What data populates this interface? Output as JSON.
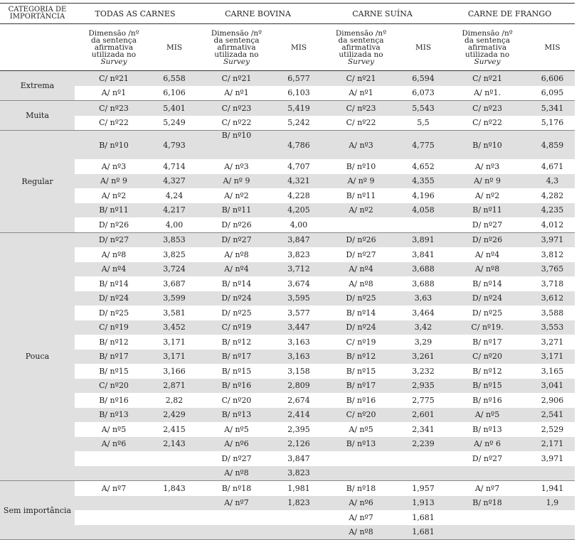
{
  "header": {
    "category": "CATEGORIA DE IMPORTÂNCIA",
    "groups": [
      "TODAS AS CARNES",
      "CARNE BOVINA",
      "CARNE SUÍNA",
      "CARNE DE FRANGO"
    ],
    "dim_lines": [
      "Dimensão /nº",
      "da sentença",
      "afirmativa",
      "utilizada no"
    ],
    "survey": "Survey",
    "mis": "MIS"
  },
  "categories": [
    "Extrema",
    "Muita",
    "Regular",
    "Pouca",
    "Sem importância"
  ],
  "rows": [
    [
      "C/ nº21",
      "6,558",
      "C/ nº21",
      "6,577",
      "C/ nº21",
      "6,594",
      "C/ nº21",
      "6,606"
    ],
    [
      "A/ nº1",
      "6,106",
      "A/ nº1",
      "6,103",
      "A/ nº1",
      "6,073",
      "A/ nº1.",
      "6,095"
    ],
    [
      "C/ nº23",
      "5,401",
      "C/ nº23",
      "5,419",
      "C/ nº23",
      "5,543",
      "C/ nº23",
      "5,341"
    ],
    [
      "C/ nº22",
      "5,249",
      "C/ nº22",
      "5,242",
      "C/ nº22",
      "5,5",
      "C/ nº22",
      "5,176"
    ],
    [
      "B/ nº10",
      "4,793",
      "B/ nº10",
      "4,786",
      "A/ nº3",
      "4,775",
      "B/ nº10",
      "4,859"
    ],
    [
      "A/ nº3",
      "4,714",
      "A/ nº3",
      "4,707",
      "B/ nº10",
      "4,652",
      "A/ nº3",
      "4,671"
    ],
    [
      "A/ nº 9",
      "4,327",
      "A/ nº 9",
      "4,321",
      "A/ nº 9",
      "4,355",
      "A/ nº 9",
      "4,3"
    ],
    [
      "A/ nº2",
      "4,24",
      "A/ nº2",
      "4,228",
      "B/ nº11",
      "4,196",
      "A/ nº2",
      "4,282"
    ],
    [
      "B/ nº11",
      "4,217",
      "B/ nº11",
      "4,205",
      "A/ nº2",
      "4,058",
      "B/ nº11",
      "4,235"
    ],
    [
      "D/ nº26",
      "4,00",
      "D/ nº26",
      "4,00",
      "",
      "",
      "D/ nº27",
      "4,012"
    ],
    [
      "D/ nº27",
      "3,853",
      "D/ nº27",
      "3,847",
      "D/ nº26",
      "3,891",
      "D/ nº26",
      "3,971"
    ],
    [
      "A/ nº8",
      "3,825",
      "A/ nº8",
      "3,823",
      "D/ nº27",
      "3,841",
      "A/ nº4",
      "3,812"
    ],
    [
      "A/ nº4",
      "3,724",
      "A/ nº4",
      "3,712",
      "A/ nº4",
      "3,688",
      "A/ nº8",
      "3,765"
    ],
    [
      "B/ nº14",
      "3,687",
      "B/ nº14",
      "3,674",
      "A/ nº8",
      "3,688",
      "B/ nº14",
      "3,718"
    ],
    [
      "D/ nº24",
      "3,599",
      "D/ nº24",
      "3,595",
      "D/ nº25",
      "3,63",
      "D/ nº24",
      "3,612"
    ],
    [
      "D/ nº25",
      "3,581",
      "D/ nº25",
      "3,577",
      "B/ nº14",
      "3,464",
      "D/ nº25",
      "3,588"
    ],
    [
      "C/ nº19",
      "3,452",
      "C/ nº19",
      "3,447",
      "D/ nº24",
      "3,42",
      "C/ nº19.",
      "3,553"
    ],
    [
      "B/ nº12",
      "3,171",
      "B/ nº12",
      "3,163",
      "C/ nº19",
      "3,29",
      "B/ nº17",
      "3,271"
    ],
    [
      "B/ nº17",
      "3,171",
      "B/ nº17",
      "3,163",
      "B/ nº12",
      "3,261",
      "C/ nº20",
      "3,171"
    ],
    [
      "B/ nº15",
      "3,166",
      "B/ nº15",
      "3,158",
      "B/ nº15",
      "3,232",
      "B/ nº12",
      "3,165"
    ],
    [
      "C/ nº20",
      "2,871",
      "B/ nº16",
      "2,809",
      "B/ nº17",
      "2,935",
      "B/ nº15",
      "3,041"
    ],
    [
      "B/ nº16",
      "2,82",
      "C/ nº20",
      "2,674",
      "B/ nº16",
      "2,775",
      "B/ nº16",
      "2,906"
    ],
    [
      "B/ nº13",
      "2,429",
      "B/ nº13",
      "2,414",
      "C/ nº20",
      "2,601",
      "A/ nº5",
      "2,541"
    ],
    [
      "A/ nº5",
      "2,415",
      "A/ nº5",
      "2,395",
      "A/ nº5",
      "2,341",
      "B/ nº13",
      "2,529"
    ],
    [
      "A/ nº6",
      "2,143",
      "A/ nº6",
      "2,126",
      "B/ nº13",
      "2,239",
      "A/ nº 6",
      "2,171"
    ],
    [
      "",
      "",
      "D/ nº27",
      "3,847",
      "",
      "",
      "D/ nº27",
      "3,971"
    ],
    [
      "",
      "",
      "A/ nº8",
      "3,823",
      "",
      "",
      "",
      ""
    ],
    [
      "A/ nº7",
      "1,843",
      "B/ nº18",
      "1,981",
      "B/ nº18",
      "1,957",
      "A/ nº7",
      "1,941"
    ],
    [
      "",
      "",
      "A/ nº7",
      "1,823",
      "A/ nº6",
      "1,913",
      "B/ nº18",
      "1,9"
    ],
    [
      "",
      "",
      "",
      "",
      "A/ nº7",
      "1,681",
      "",
      ""
    ],
    [
      "",
      "",
      "",
      "",
      "A/ nº8",
      "1,681",
      "",
      ""
    ]
  ]
}
